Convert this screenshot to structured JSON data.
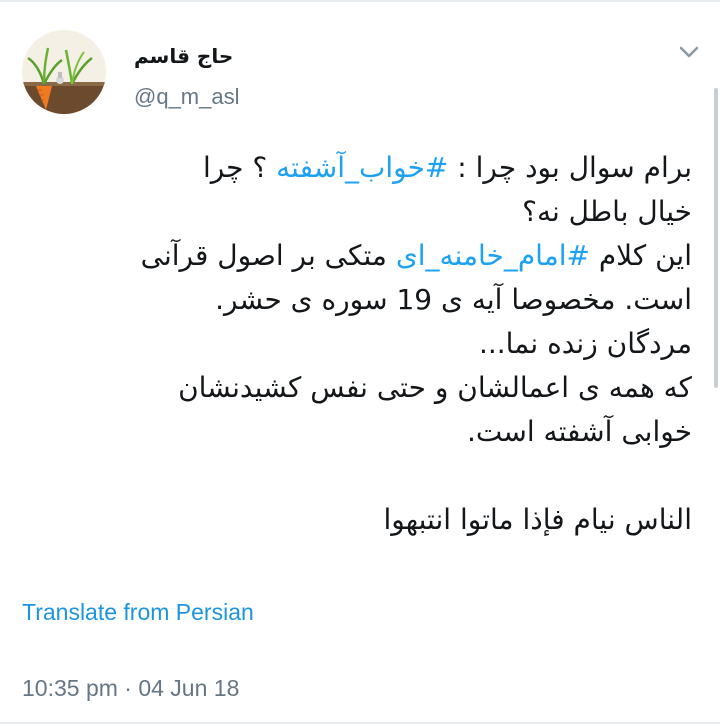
{
  "author": {
    "display_name": "حاج قاسم",
    "handle": "@q_m_asl",
    "avatar_icon": "carrot-plant-avatar"
  },
  "tweet": {
    "line1": {
      "before": "برام سوال بود چرا : ",
      "hashtag": "#خواب_آشفته",
      "after": " ؟ چرا"
    },
    "line2": "خیال باطل نه؟",
    "line3": {
      "before": "این کلام ",
      "hashtag": "#امام_خامنه_ای",
      "after": " متکی بر اصول قرآنی"
    },
    "line4": "است. مخصوصا آیه ی 19 سوره ی حشر.",
    "line5": "مردگان زنده نما...",
    "line6": "که همه ی اعمالشان و حتی نفس کشیدنشان",
    "line7": "خوابی آشفته است.",
    "line8": "الناس نیام فإذا ماتوا انتبهوا"
  },
  "translate_label": "Translate from Persian",
  "timestamp": "10:35 pm · 04 Jun 18",
  "menu_icon": "chevron-down-icon",
  "colors": {
    "hashtag": "#1da1f2",
    "link": "#1b95e0",
    "muted": "#657786",
    "text": "#14171a"
  }
}
